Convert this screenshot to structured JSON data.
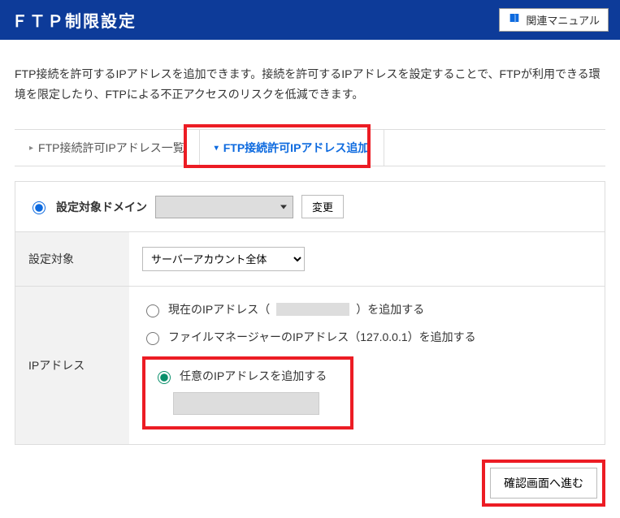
{
  "header": {
    "title": "ＦＴＰ制限設定",
    "manual_label": "関連マニュアル"
  },
  "description": "FTP接続を許可するIPアドレスを追加できます。接続を許可するIPアドレスを設定することで、FTPが利用できる環境を限定したり、FTPによる不正アクセスのリスクを低減できます。",
  "tabs": {
    "list_label": "FTP接続許可IPアドレス一覧",
    "add_label": "FTP接続許可IPアドレス追加"
  },
  "domain": {
    "label": "設定対象ドメイン",
    "change_label": "変更",
    "selected": ""
  },
  "settings": {
    "target_label": "設定対象",
    "target_value": "サーバーアカウント全体",
    "ip_label": "IPアドレス",
    "opt_current_prefix": "現在のIPアドレス（",
    "opt_current_suffix": "）を追加する",
    "opt_fm": "ファイルマネージャーのIPアドレス（127.0.0.1）を追加する",
    "opt_custom": "任意のIPアドレスを追加する",
    "custom_value": ""
  },
  "footer": {
    "proceed_label": "確認画面へ進む"
  }
}
